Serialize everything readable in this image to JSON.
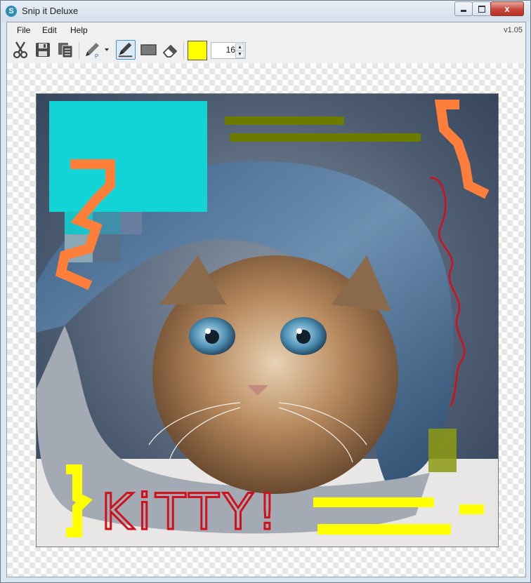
{
  "window": {
    "title": "Snip it Deluxe",
    "app_icon": "S",
    "minimize_glyph": "",
    "maximize_glyph": "",
    "close_glyph": "x"
  },
  "menu": {
    "items": [
      "File",
      "Edit",
      "Help"
    ],
    "version": "v1.05"
  },
  "toolbar": {
    "tools": [
      "scissors-icon",
      "save-icon",
      "copy-icon",
      "pen-icon",
      "marker-icon",
      "rectangle-icon",
      "eraser-icon"
    ],
    "active_tool": "marker-icon",
    "pen_badge": "P",
    "color": "#ffff00",
    "brush_size": "16",
    "spin_up": "▲",
    "spin_down": "▼"
  },
  "canvas": {
    "annotation_text": "KiTTY!"
  },
  "colors": {
    "highlight_yellow": "#ffff00",
    "highlight_olive": "#6b7a00",
    "scribble_orange": "#ff7f3a",
    "scribble_red": "#d0101a",
    "cyan_block": "#12d3d6"
  }
}
